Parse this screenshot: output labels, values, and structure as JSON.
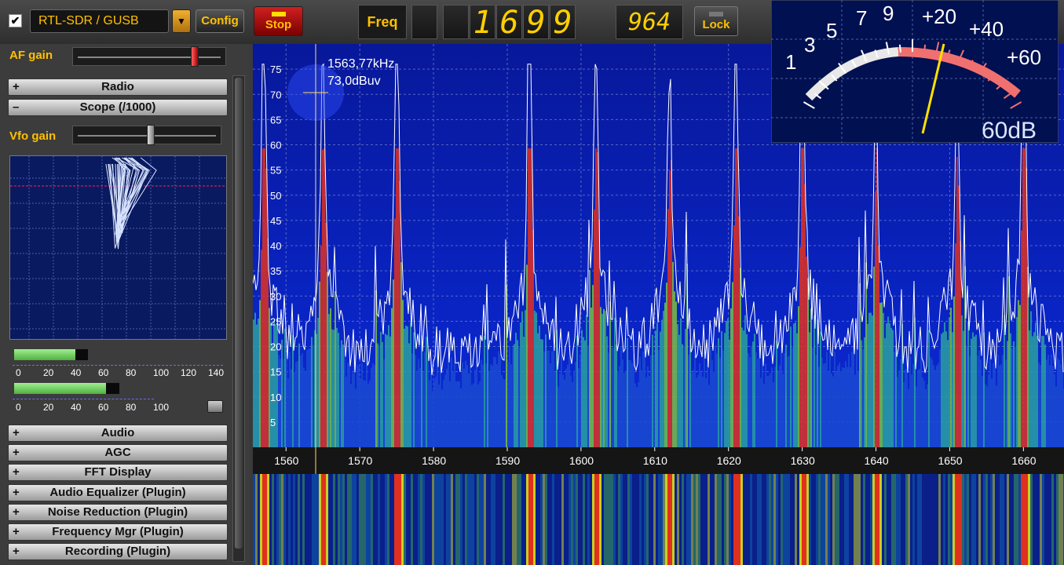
{
  "toolbar": {
    "enabled": true,
    "device_label": "RTL-SDR / GUSB",
    "config_label": "Config",
    "stop_label": "Stop",
    "freq_label": "Freq",
    "freq_digits": [
      "",
      "",
      "1",
      "6",
      "9",
      "9"
    ],
    "freq_tail": "964",
    "lock_label": "Lock"
  },
  "left_panel": {
    "af_gain_label": "AF gain",
    "af_gain_level": 0.85,
    "vfo_gain_label": "Vfo gain",
    "vfo_gain_level": 0.55,
    "sections_top": [
      {
        "sign": "+",
        "label": "Radio"
      },
      {
        "sign": "–",
        "label": "Scope (/1000)"
      }
    ],
    "meter1": {
      "value": 52,
      "max": 150,
      "ticks": [
        "0",
        "20",
        "40",
        "60",
        "80",
        "100",
        "120",
        "140"
      ]
    },
    "meter2": {
      "value": 72,
      "max": 110,
      "ticks": [
        "0",
        "20",
        "40",
        "60",
        "80",
        "100"
      ]
    },
    "sections_bottom": [
      {
        "sign": "+",
        "label": "Audio"
      },
      {
        "sign": "+",
        "label": "AGC"
      },
      {
        "sign": "+",
        "label": "FFT Display"
      },
      {
        "sign": "+",
        "label": "Audio Equalizer (Plugin)"
      },
      {
        "sign": "+",
        "label": "Noise Reduction (Plugin)"
      },
      {
        "sign": "+",
        "label": "Frequency Mgr (Plugin)"
      },
      {
        "sign": "+",
        "label": "Recording (Plugin)"
      }
    ]
  },
  "spectrum": {
    "cursor_freq": "1563,77kHz",
    "cursor_level": "73,0dBuv",
    "y_ticks": [
      "5",
      "10",
      "15",
      "20",
      "25",
      "30",
      "35",
      "40",
      "45",
      "50",
      "55",
      "60",
      "65",
      "70",
      "75"
    ],
    "x_ticks": [
      "1560",
      "1570",
      "1580",
      "1590",
      "1600",
      "1610",
      "1620",
      "1630",
      "1640",
      "1650",
      "1660"
    ],
    "x_range_khz": [
      1555.5,
      1665.5
    ],
    "y_range": [
      0,
      80
    ],
    "peaks_khz": [
      1557,
      1565,
      1575,
      1593,
      1602,
      1612,
      1621,
      1630,
      1640,
      1651,
      1660
    ],
    "peak_levels": [
      55,
      50,
      60,
      62,
      53,
      42,
      55,
      52,
      37,
      42,
      62
    ],
    "background_color": "#0a1fa8",
    "trace_color": "#ffffff"
  },
  "smeter": {
    "scale_labels": [
      "1",
      "3",
      "5",
      "7",
      "9",
      "+20",
      "+40",
      "+60"
    ],
    "readout": "60dB"
  }
}
